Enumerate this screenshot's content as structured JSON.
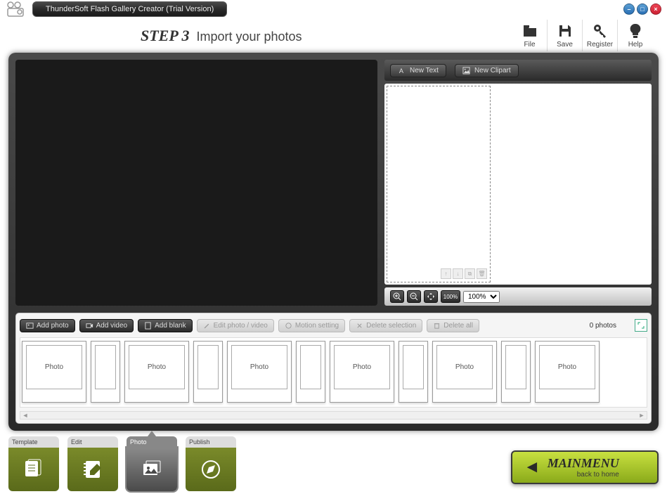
{
  "app_title": "ThunderSoft Flash Gallery Creator (Trial Version)",
  "step": {
    "number": "STEP 3",
    "label": "Import your photos"
  },
  "top_toolbar": [
    {
      "label": "File"
    },
    {
      "label": "Save"
    },
    {
      "label": "Register"
    },
    {
      "label": "Help"
    }
  ],
  "text_buttons": {
    "new_text": "New Text",
    "new_clipart": "New Clipart"
  },
  "zoom": {
    "value": "100%",
    "hundred": "100%"
  },
  "shelf": {
    "add_photo": "Add photo",
    "add_video": "Add video",
    "add_blank": "Add blank",
    "edit": "Edit photo / video",
    "motion": "Motion setting",
    "delete_sel": "Delete selection",
    "delete_all": "Delete all",
    "count": "0 photos",
    "placeholder": "Photo"
  },
  "nav": {
    "template": "Template",
    "edit": "Edit",
    "photo": "Photo",
    "publish": "Publish"
  },
  "mainmenu": {
    "title": "MAINMENU",
    "sub": "back to home"
  }
}
